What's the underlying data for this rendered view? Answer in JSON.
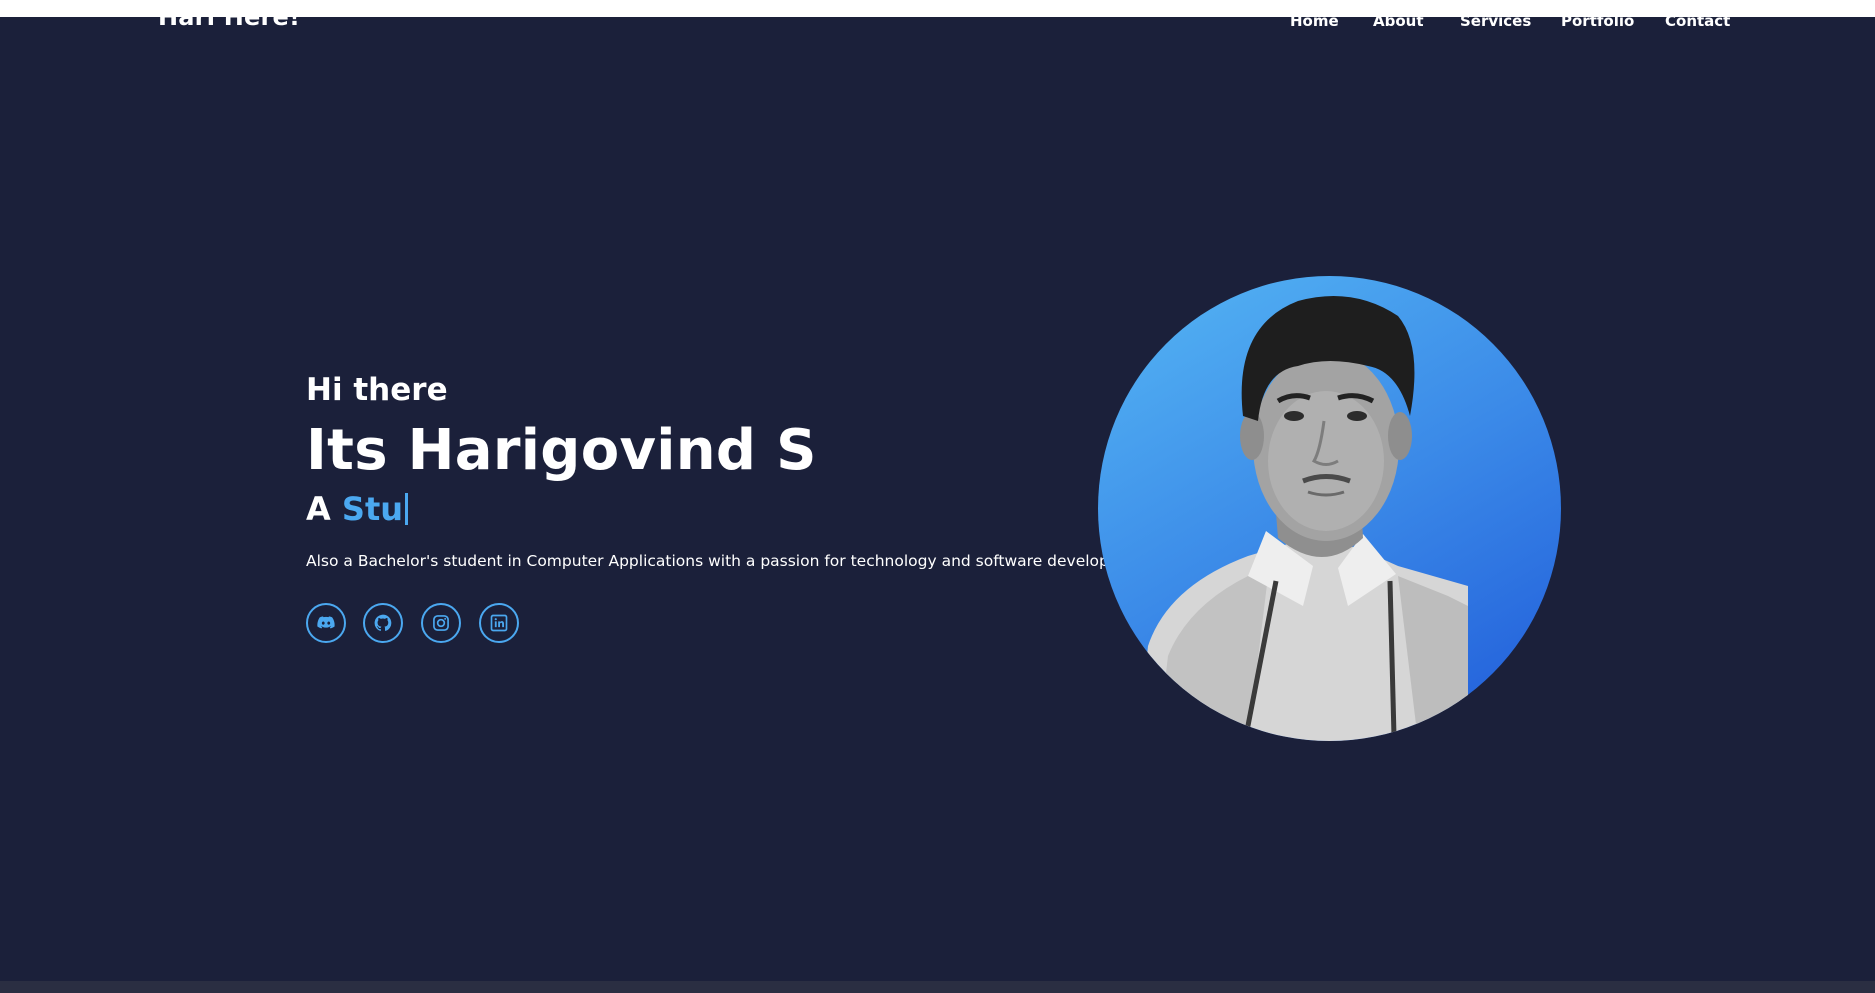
{
  "navbar": {
    "logo": "Hari Here!",
    "links": [
      "Home",
      "About",
      "Services",
      "Portfolio",
      "Contact"
    ]
  },
  "hero": {
    "greeting": "Hi there",
    "name": "Its Harigovind S",
    "role_prefix": "A",
    "role_typed": "Stu",
    "description": "Also a Bachelor's student in Computer Applications with a passion for technology and software development.",
    "socials": [
      "discord-icon",
      "github-icon",
      "instagram-icon",
      "linkedin-icon"
    ]
  },
  "colors": {
    "background": "#1b203a",
    "accent": "#4ba8f0",
    "text": "#ffffff"
  }
}
